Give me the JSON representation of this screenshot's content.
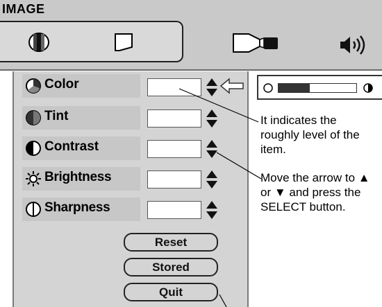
{
  "menu": {
    "title": "IMAGE"
  },
  "items": [
    {
      "label": "Color",
      "icon": "color-icon"
    },
    {
      "label": "Tint",
      "icon": "tint-icon"
    },
    {
      "label": "Contrast",
      "icon": "contrast-icon"
    },
    {
      "label": "Brightness",
      "icon": "brightness-icon"
    },
    {
      "label": "Sharpness",
      "icon": "sharpness-icon"
    }
  ],
  "buttons": {
    "reset": "Reset",
    "stored": "Stored",
    "quit": "Quit"
  },
  "level": {
    "fill_fraction": 0.4
  },
  "notes": {
    "indicator": "It indicates the roughly level of the item.",
    "move": "Move the arrow to ▲ or ▼ and press the SELECT button."
  },
  "colors": {
    "menu_bg": "#c9c9c9",
    "panel_bg": "#d4d4d4",
    "row_bg": "#c7c7c7"
  }
}
